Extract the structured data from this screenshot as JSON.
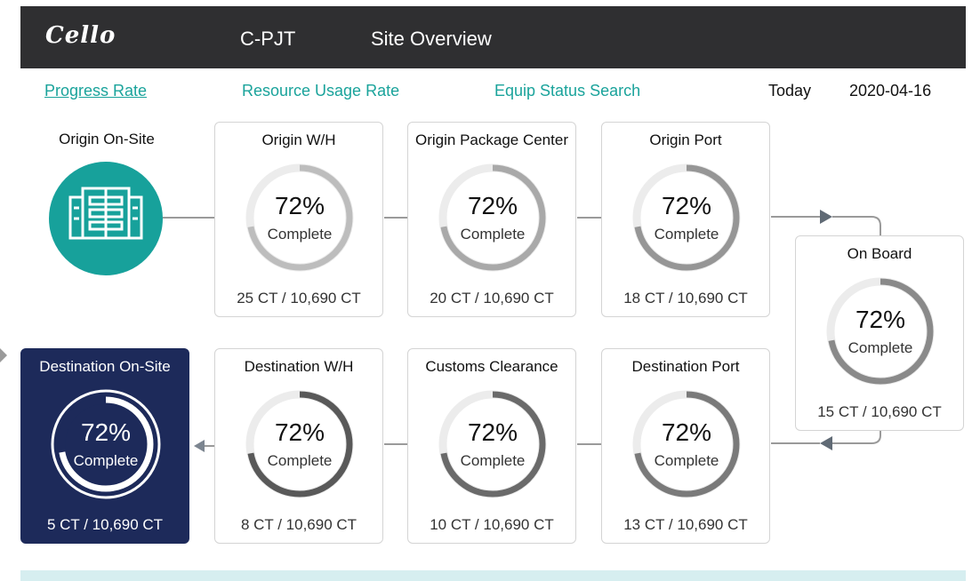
{
  "header": {
    "logo": "Cello",
    "project": "C-PJT",
    "title": "Site Overview"
  },
  "nav": {
    "links": [
      "Progress Rate",
      "Resource Usage Rate",
      "Equip Status Search"
    ],
    "today_label": "Today",
    "today_value": "2020-04-16"
  },
  "origin_onsite": {
    "title": "Origin On-Site",
    "icon": "building-icon"
  },
  "stages": [
    {
      "title": "Origin W/H",
      "pct": "72%",
      "label": "Complete",
      "count": "25 CT / 10,690 CT",
      "progress": 0.72
    },
    {
      "title": "Origin Package Center",
      "pct": "72%",
      "label": "Complete",
      "count": "20 CT / 10,690 CT",
      "progress": 0.72
    },
    {
      "title": "Origin Port",
      "pct": "72%",
      "label": "Complete",
      "count": "18 CT / 10,690 CT",
      "progress": 0.72
    },
    {
      "title": "On Board",
      "pct": "72%",
      "label": "Complete",
      "count": "15 CT / 10,690 CT",
      "progress": 0.72
    },
    {
      "title": "Destination Port",
      "pct": "72%",
      "label": "Complete",
      "count": "13 CT / 10,690 CT",
      "progress": 0.72
    },
    {
      "title": "Customs Clearance",
      "pct": "72%",
      "label": "Complete",
      "count": "10 CT / 10,690 CT",
      "progress": 0.72
    },
    {
      "title": "Destination W/H",
      "pct": "72%",
      "label": "Complete",
      "count": "8 CT / 10,690 CT",
      "progress": 0.72
    },
    {
      "title": "Destination On-Site",
      "pct": "72%",
      "label": "Complete",
      "count": "5 CT / 10,690 CT",
      "progress": 0.72
    }
  ],
  "colors": {
    "accent": "#17a19b",
    "dark_card": "#1d2a5a",
    "topbar": "#2f2f31"
  }
}
